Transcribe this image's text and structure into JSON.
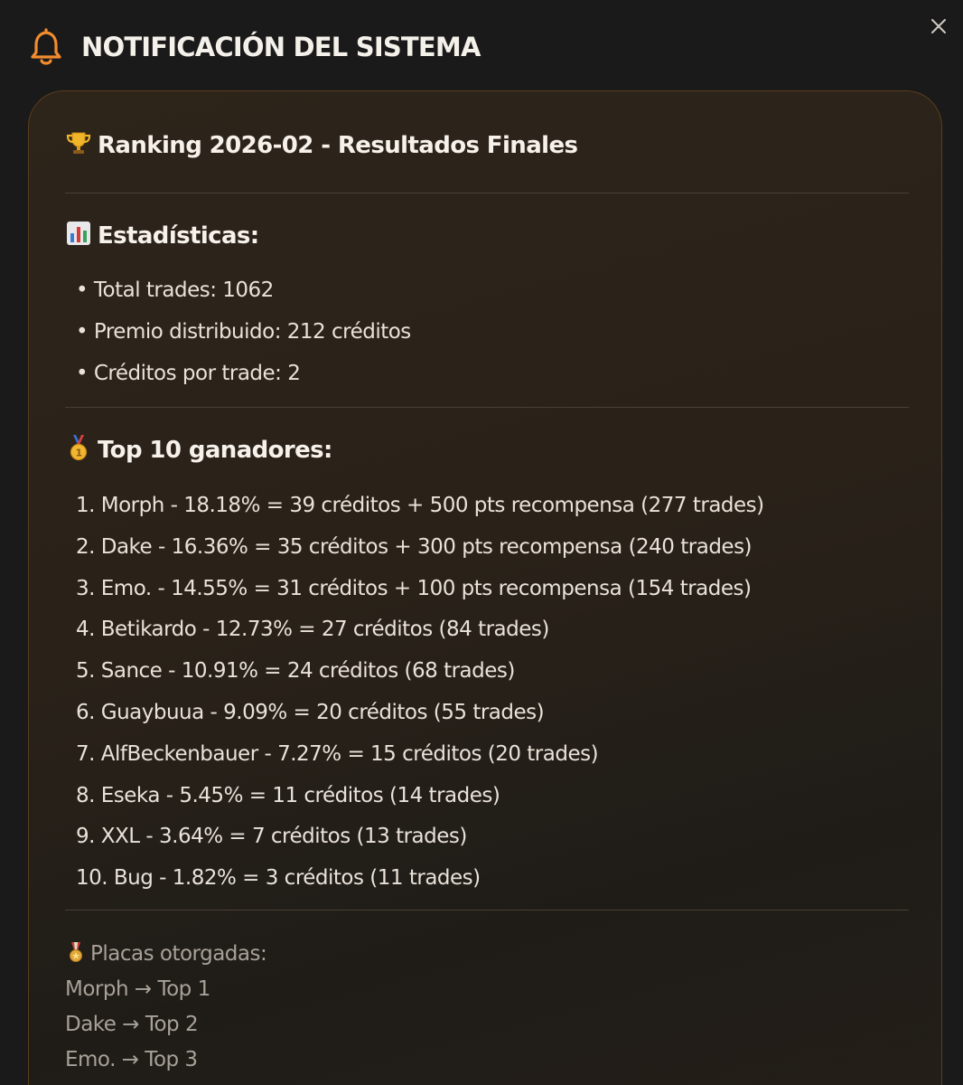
{
  "header": {
    "title": "NOTIFICACIÓN DEL SISTEMA",
    "icon": "bell-icon",
    "accent": "#f28c2f"
  },
  "message": {
    "title": "Ranking 2026-02 - Resultados Finales",
    "stats": {
      "heading": "Estadísticas:",
      "items": [
        "• Total trades: 1062",
        "• Premio distribuido: 212 créditos",
        "• Créditos por trade: 2"
      ]
    },
    "winners": {
      "heading": "Top 10 ganadores:",
      "items": [
        "1. Morph - 18.18% = 39 créditos + 500 pts recompensa (277 trades)",
        "2. Dake - 16.36% = 35 créditos + 300 pts recompensa (240 trades)",
        "3. Emo. - 14.55% = 31 créditos + 100 pts recompensa (154 trades)",
        "4. Betikardo - 12.73% = 27 créditos (84 trades)",
        "5. Sance - 10.91% = 24 créditos (68 trades)",
        "6. Guaybuua - 9.09% = 20 créditos (55 trades)",
        "7. AlfBeckenbauer - 7.27% = 15 créditos (20 trades)",
        "8. Eseka - 5.45% = 11 créditos (14 trades)",
        "9. XXL - 3.64% = 7 créditos (13 trades)",
        "10. Bug - 1.82% = 3 créditos (11 trades)"
      ]
    },
    "awards": {
      "heading": "Placas otorgadas:",
      "items": [
        "Morph → Top 1",
        "Dake → Top 2",
        "Emo. → Top 3"
      ]
    }
  }
}
